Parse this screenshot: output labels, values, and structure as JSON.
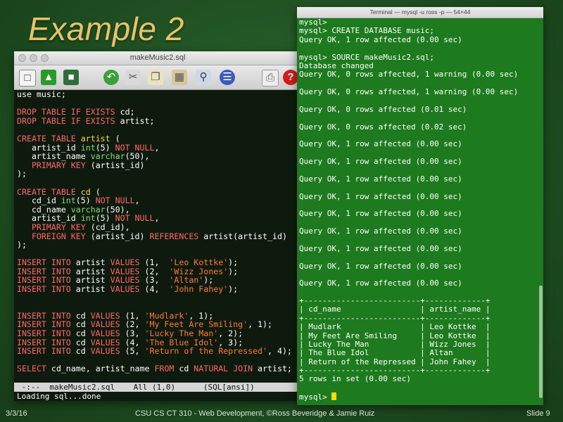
{
  "slide": {
    "title": "Example 2",
    "footer_date": "3/3/16",
    "footer_center": "CSU CS CT 310 - Web Development, ©Ross Beveridge & Jamie Ruiz",
    "footer_slide": "Slide 9"
  },
  "editor": {
    "window_title": "makeMusic2.sql",
    "toolbar_icons": [
      "new-file-icon",
      "open-file-icon",
      "save-icon",
      "undo-icon",
      "cut-icon",
      "copy-icon",
      "paste-icon",
      "search-icon",
      "preferences-icon",
      "print-icon",
      "help-icon"
    ],
    "mode_line": " -:--  makeMusic2.sql    All (1,0)      (SQL[ansi])",
    "echo_line": "Loading sql...done",
    "code_lines": [
      [
        [
          "w",
          "use music;"
        ]
      ],
      [],
      [
        [
          "k",
          "DROP TABLE IF EXISTS"
        ],
        [
          "w",
          " cd;"
        ]
      ],
      [
        [
          "k",
          "DROP TABLE IF EXISTS"
        ],
        [
          "w",
          " artist;"
        ]
      ],
      [],
      [
        [
          "k",
          "CREATE TABLE "
        ],
        [
          "y",
          "artist"
        ],
        [
          "w",
          " ("
        ]
      ],
      [
        [
          "w",
          "   artist_id "
        ],
        [
          "t",
          "int"
        ],
        [
          "w",
          "(5) "
        ],
        [
          "k",
          "NOT NULL"
        ],
        [
          "w",
          ","
        ]
      ],
      [
        [
          "w",
          "   artist_name "
        ],
        [
          "t",
          "varchar"
        ],
        [
          "w",
          "(50),"
        ]
      ],
      [
        [
          "w",
          "   "
        ],
        [
          "k",
          "PRIMARY KEY"
        ],
        [
          "w",
          " (artist_id)"
        ]
      ],
      [
        [
          "w",
          ");"
        ]
      ],
      [],
      [
        [
          "k",
          "CREATE TABLE "
        ],
        [
          "y",
          "cd"
        ],
        [
          "w",
          " ("
        ]
      ],
      [
        [
          "w",
          "   cd_id "
        ],
        [
          "t",
          "int"
        ],
        [
          "w",
          "(5) "
        ],
        [
          "k",
          "NOT NULL"
        ],
        [
          "w",
          ","
        ]
      ],
      [
        [
          "w",
          "   cd_name "
        ],
        [
          "t",
          "varchar"
        ],
        [
          "w",
          "(50),"
        ]
      ],
      [
        [
          "w",
          "   artist_id "
        ],
        [
          "t",
          "int"
        ],
        [
          "w",
          "(5) "
        ],
        [
          "k",
          "NOT NULL"
        ],
        [
          "w",
          ","
        ]
      ],
      [
        [
          "w",
          "   "
        ],
        [
          "k",
          "PRIMARY KEY"
        ],
        [
          "w",
          " (cd_id),"
        ]
      ],
      [
        [
          "w",
          "   "
        ],
        [
          "k",
          "FOREIGN KEY"
        ],
        [
          "w",
          " (artist_id) "
        ],
        [
          "k",
          "REFERENCES"
        ],
        [
          "w",
          " artist(artist_id)"
        ]
      ],
      [
        [
          "w",
          ");"
        ]
      ],
      [],
      [
        [
          "k",
          "INSERT INTO"
        ],
        [
          "w",
          " artist "
        ],
        [
          "k",
          "VALUES"
        ],
        [
          "w",
          " (1,  "
        ],
        [
          "s",
          "'Leo Kottke'"
        ],
        [
          "w",
          ");"
        ]
      ],
      [
        [
          "k",
          "INSERT INTO"
        ],
        [
          "w",
          " artist "
        ],
        [
          "k",
          "VALUES"
        ],
        [
          "w",
          " (2,  "
        ],
        [
          "s",
          "'Wizz Jones'"
        ],
        [
          "w",
          ");"
        ]
      ],
      [
        [
          "k",
          "INSERT INTO"
        ],
        [
          "w",
          " artist "
        ],
        [
          "k",
          "VALUES"
        ],
        [
          "w",
          " (3,  "
        ],
        [
          "s",
          "'Altan'"
        ],
        [
          "w",
          ");"
        ]
      ],
      [
        [
          "k",
          "INSERT INTO"
        ],
        [
          "w",
          " artist "
        ],
        [
          "k",
          "VALUES"
        ],
        [
          "w",
          " (4,  "
        ],
        [
          "s",
          "'John Fahey'"
        ],
        [
          "w",
          ");"
        ]
      ],
      [],
      [],
      [
        [
          "k",
          "INSERT INTO"
        ],
        [
          "w",
          " cd "
        ],
        [
          "k",
          "VALUES"
        ],
        [
          "w",
          " (1, "
        ],
        [
          "s",
          "'Mudlark'"
        ],
        [
          "w",
          ", 1);"
        ]
      ],
      [
        [
          "k",
          "INSERT INTO"
        ],
        [
          "w",
          " cd "
        ],
        [
          "k",
          "VALUES"
        ],
        [
          "w",
          " (2, "
        ],
        [
          "s",
          "'My Feet Are Smiling'"
        ],
        [
          "w",
          ", 1);"
        ]
      ],
      [
        [
          "k",
          "INSERT INTO"
        ],
        [
          "w",
          " cd "
        ],
        [
          "k",
          "VALUES"
        ],
        [
          "w",
          " (3, "
        ],
        [
          "s",
          "'Lucky The Man'"
        ],
        [
          "w",
          ", 2);"
        ]
      ],
      [
        [
          "k",
          "INSERT INTO"
        ],
        [
          "w",
          " cd "
        ],
        [
          "k",
          "VALUES"
        ],
        [
          "w",
          " (4, "
        ],
        [
          "s",
          "'The Blue Idol'"
        ],
        [
          "w",
          ", 3);"
        ]
      ],
      [
        [
          "k",
          "INSERT INTO"
        ],
        [
          "w",
          " cd "
        ],
        [
          "k",
          "VALUES"
        ],
        [
          "w",
          " (5, "
        ],
        [
          "s",
          "'Return of the Repressed'"
        ],
        [
          "w",
          ", 4);"
        ]
      ],
      [],
      [
        [
          "k",
          "SELECT"
        ],
        [
          "w",
          " cd_name, artist_name "
        ],
        [
          "k",
          "FROM"
        ],
        [
          "w",
          " cd "
        ],
        [
          "k",
          "NATURAL JOIN"
        ],
        [
          "w",
          " artist;"
        ]
      ]
    ]
  },
  "terminal": {
    "window_title": "Terminal — mysql -u ross -p — 54×44",
    "lines": [
      "mysql>",
      "mysql> CREATE DATABASE music;",
      "Query OK, 1 row affected (0.00 sec)",
      "",
      "mysql> SOURCE makeMusic2.sql;",
      "Database changed",
      "Query OK, 0 rows affected, 1 warning (0.00 sec)",
      "",
      "Query OK, 0 rows affected, 1 warning (0.00 sec)",
      "",
      "Query OK, 0 rows affected (0.01 sec)",
      "",
      "Query OK, 0 rows affected (0.02 sec)",
      "",
      "Query OK, 1 row affected (0.00 sec)",
      "",
      "Query OK, 1 row affected (0.00 sec)",
      "",
      "Query OK, 1 row affected (0.00 sec)",
      "",
      "Query OK, 1 row affected (0.00 sec)",
      "",
      "Query OK, 1 row affected (0.00 sec)",
      "",
      "Query OK, 1 row affected (0.00 sec)",
      "",
      "Query OK, 1 row affected (0.00 sec)",
      "",
      "Query OK, 1 row affected (0.00 sec)",
      "",
      "Query OK, 1 row affected (0.00 sec)",
      "",
      "+-------------------------+-------------+",
      "| cd_name                 | artist_name |",
      "+-------------------------+-------------+",
      "| Mudlark                 | Leo Kottke  |",
      "| My Feet Are Smiling     | Leo Kottke  |",
      "| Lucky The Man           | Wizz Jones  |",
      "| The Blue Idol           | Altan       |",
      "| Return of the Repressed | John Fahey  |",
      "+-------------------------+-------------+",
      "5 rows in set (0.00 sec)",
      "",
      "mysql> "
    ]
  },
  "colors": {
    "keyword": "#ff6767",
    "table_name": "#ffd84a",
    "type": "#7ee06c",
    "string": "#ff7a3a",
    "terminal_bg": "#1e7a1e",
    "editor_bg": "#0f1a0f",
    "title": "#e8c36a"
  }
}
